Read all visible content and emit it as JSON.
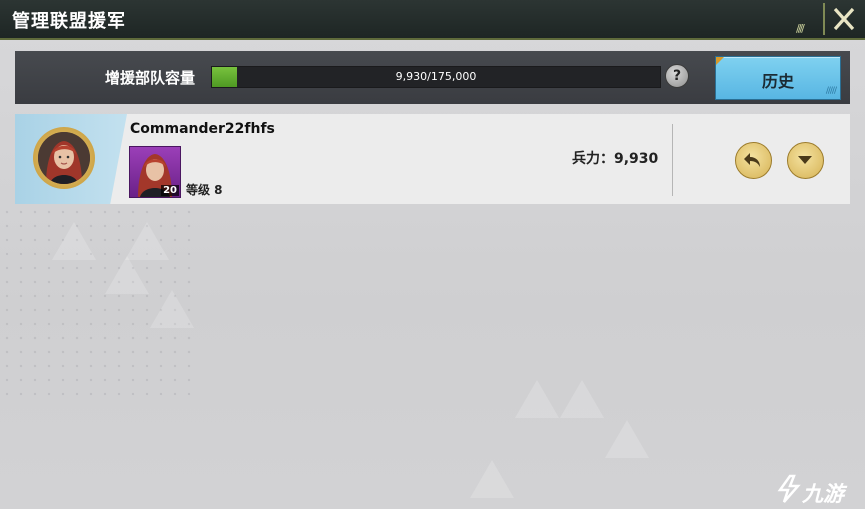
{
  "header": {
    "title": "管理联盟援军"
  },
  "capacity": {
    "label": "增援部队容量",
    "current": 9930,
    "max": 175000,
    "text": "9,930/175,000"
  },
  "help": {
    "label": "?"
  },
  "history_button": {
    "label": "历史"
  },
  "members": [
    {
      "name": "Commander22fhfs",
      "hero_level": "20",
      "level_text": "等级 8",
      "troops_text": "兵力：9,930"
    }
  ],
  "watermark": {
    "text": "九游"
  },
  "colors": {
    "accent_blue": "#6cc6ec",
    "progress_green": "#66b431",
    "button_gold": "#e2c46e",
    "titlebar": "#252e2c"
  },
  "icons": [
    "close-icon",
    "help-icon",
    "return-icon",
    "chevron-down-icon",
    "avatar-portrait",
    "hero-portrait",
    "watermark-logo-icon"
  ]
}
